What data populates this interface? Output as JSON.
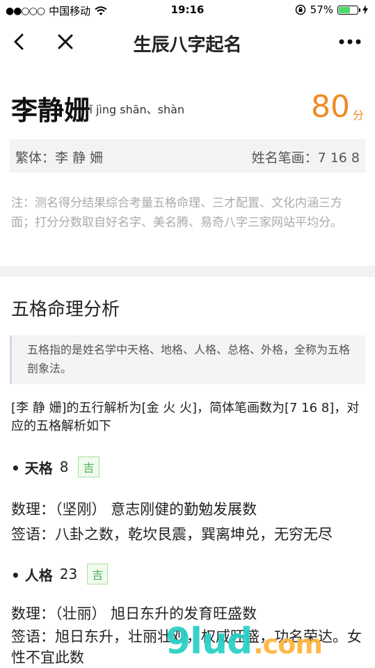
{
  "status": {
    "carrier": "中国移动",
    "signal_dots": "●●○○○",
    "time": "19:16",
    "battery_pct": "57%"
  },
  "nav": {
    "title": "生辰八字起名"
  },
  "result": {
    "name": "李静姗",
    "pinyin": "lǐ jìng shān、shàn",
    "score": "80",
    "score_unit": "分",
    "traditional": "繁体：李 静 姍",
    "strokes": "姓名笔画：7 16 8",
    "note": "注：测名得分结果综合考量五格命理、三才配置、文化内涵三方面；打分分数取自好名字、美名腾、易奇八字三家网站平均分。"
  },
  "analysis": {
    "title": "五格命理分析",
    "intro": "五格指的是姓名学中天格、地格、人格、总格、外格，全称为五格剖象法。",
    "summary": "[李 静 姗]的五行解析为[金 火 火]，简体笔画数为[7 16 8]，对应的五格解析如下",
    "grids": [
      {
        "name": "• 天格",
        "number": "8",
        "tag": "吉",
        "shuli": "数理：（坚刚） 意志刚健的勤勉发展数",
        "qianyu": "签语：八卦之数，乾坎艮震，巽离坤兑，无穷无尽"
      },
      {
        "name": "• 人格",
        "number": "23",
        "tag": "吉",
        "shuli": "数理：（壮丽） 旭日东升的发育旺盛数",
        "qianyu": "签语：旭日东升，壮丽壮观，权威旺盛，功名荣达。女性不宜此数"
      }
    ]
  },
  "watermark": {
    "brand": "9lud",
    "domain": ".com"
  }
}
